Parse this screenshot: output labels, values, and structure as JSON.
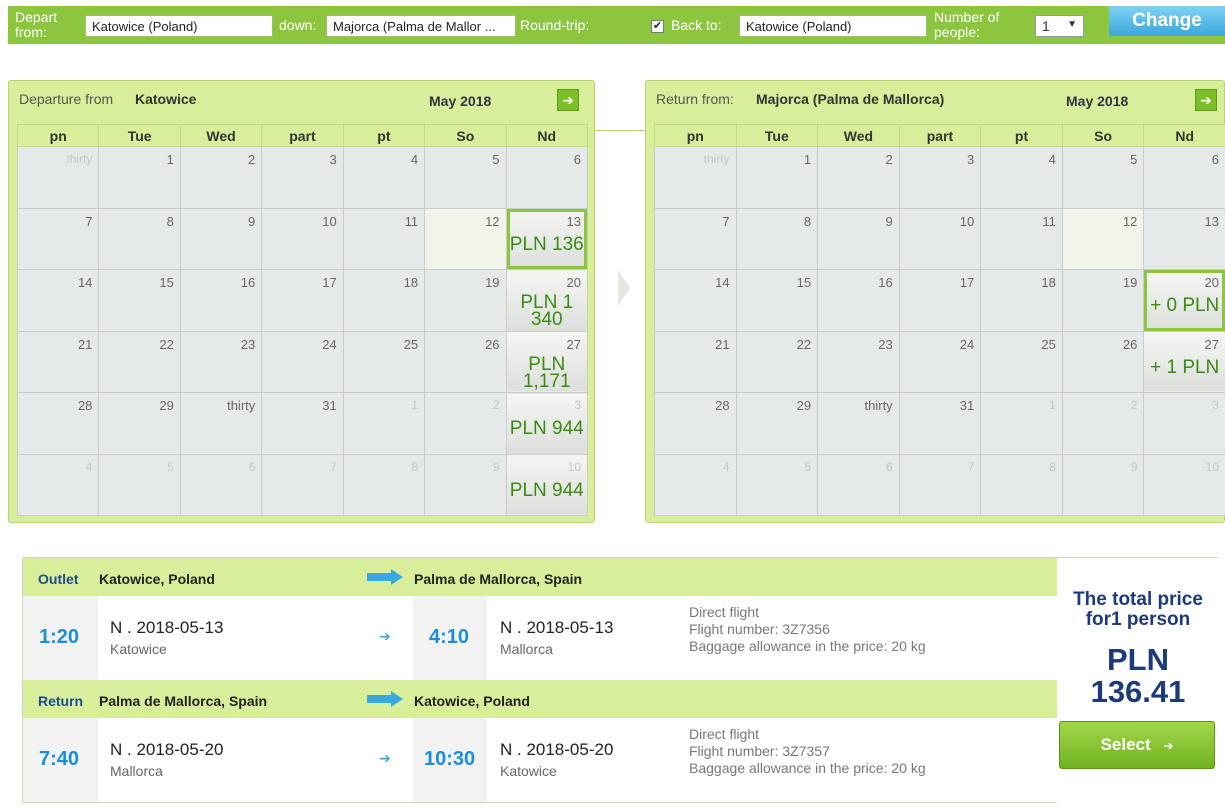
{
  "search": {
    "depart_label": "Depart\nfrom:",
    "depart_value": "Katowice (Poland)",
    "down_label": "down:",
    "down_value": "Majorca (Palma de Mallor ...",
    "roundtrip_label": "Round-trip:",
    "roundtrip_checked": "✔",
    "back_label": "Back to:",
    "back_value": "Katowice (Poland)",
    "people_label": "Number of\npeople:",
    "people_value": "1",
    "change_label": "Change"
  },
  "weekdays": [
    "pn",
    "Tue",
    "Wed",
    "part",
    "pt",
    "So",
    "Nd"
  ],
  "departure": {
    "label": "Departure from",
    "city": "Katowice",
    "month": "May 2018",
    "weeks": [
      [
        {
          "d": "thirty",
          "m": true
        },
        {
          "d": "1"
        },
        {
          "d": "2"
        },
        {
          "d": "3"
        },
        {
          "d": "4"
        },
        {
          "d": "5"
        },
        {
          "d": "6"
        }
      ],
      [
        {
          "d": "7"
        },
        {
          "d": "8"
        },
        {
          "d": "9"
        },
        {
          "d": "10"
        },
        {
          "d": "11"
        },
        {
          "d": "12",
          "today": true
        },
        {
          "d": "13",
          "price": "PLN 136",
          "sel": true
        }
      ],
      [
        {
          "d": "14"
        },
        {
          "d": "15"
        },
        {
          "d": "16"
        },
        {
          "d": "17"
        },
        {
          "d": "18"
        },
        {
          "d": "19"
        },
        {
          "d": "20",
          "price": "PLN 1 340"
        }
      ],
      [
        {
          "d": "21"
        },
        {
          "d": "22"
        },
        {
          "d": "23"
        },
        {
          "d": "24"
        },
        {
          "d": "25"
        },
        {
          "d": "26"
        },
        {
          "d": "27",
          "price": "PLN 1,171"
        }
      ],
      [
        {
          "d": "28"
        },
        {
          "d": "29"
        },
        {
          "d": "thirty"
        },
        {
          "d": "31"
        },
        {
          "d": "1",
          "m": true
        },
        {
          "d": "2",
          "m": true
        },
        {
          "d": "3",
          "m": true,
          "price": "PLN 944"
        }
      ],
      [
        {
          "d": "4",
          "m": true
        },
        {
          "d": "5",
          "m": true
        },
        {
          "d": "6",
          "m": true
        },
        {
          "d": "7",
          "m": true
        },
        {
          "d": "8",
          "m": true
        },
        {
          "d": "9",
          "m": true
        },
        {
          "d": "10",
          "m": true,
          "price": "PLN 944"
        }
      ]
    ]
  },
  "return": {
    "label": "Return from:",
    "city": "Majorca (Palma de Mallorca)",
    "month": "May 2018",
    "weeks": [
      [
        {
          "d": "thirty",
          "m": true
        },
        {
          "d": "1"
        },
        {
          "d": "2"
        },
        {
          "d": "3"
        },
        {
          "d": "4"
        },
        {
          "d": "5"
        },
        {
          "d": "6"
        }
      ],
      [
        {
          "d": "7"
        },
        {
          "d": "8"
        },
        {
          "d": "9"
        },
        {
          "d": "10"
        },
        {
          "d": "11"
        },
        {
          "d": "12",
          "today": true
        },
        {
          "d": "13"
        }
      ],
      [
        {
          "d": "14"
        },
        {
          "d": "15"
        },
        {
          "d": "16"
        },
        {
          "d": "17"
        },
        {
          "d": "18"
        },
        {
          "d": "19"
        },
        {
          "d": "20",
          "price": "+ 0 PLN",
          "sel": true
        }
      ],
      [
        {
          "d": "21"
        },
        {
          "d": "22"
        },
        {
          "d": "23"
        },
        {
          "d": "24"
        },
        {
          "d": "25"
        },
        {
          "d": "26"
        },
        {
          "d": "27",
          "price": "+ 1 PLN"
        }
      ],
      [
        {
          "d": "28"
        },
        {
          "d": "29"
        },
        {
          "d": "thirty"
        },
        {
          "d": "31"
        },
        {
          "d": "1",
          "m": true
        },
        {
          "d": "2",
          "m": true
        },
        {
          "d": "3",
          "m": true
        }
      ],
      [
        {
          "d": "4",
          "m": true
        },
        {
          "d": "5",
          "m": true
        },
        {
          "d": "6",
          "m": true
        },
        {
          "d": "7",
          "m": true
        },
        {
          "d": "8",
          "m": true
        },
        {
          "d": "9",
          "m": true
        },
        {
          "d": "10",
          "m": true
        }
      ]
    ]
  },
  "outlet": {
    "type": "Outlet",
    "from": "Katowice, Poland",
    "to": "Palma de Mallorca, Spain",
    "dep_time": "1:20",
    "dep_date": "N . 2018-05-13",
    "dep_city": "Katowice",
    "arr_time": "4:10",
    "arr_date": "N . 2018-05-13",
    "arr_city": "Mallorca",
    "info1": "Direct flight",
    "info2": "Flight number: 3Z7356",
    "info3": "Baggage allowance in the price: 20 kg"
  },
  "return_leg": {
    "type": "Return",
    "from": "Palma de Mallorca, Spain",
    "to": "Katowice, Poland",
    "dep_time": "7:40",
    "dep_date": "N . 2018-05-20",
    "dep_city": "Mallorca",
    "arr_time": "10:30",
    "arr_date": "N . 2018-05-20",
    "arr_city": "Katowice",
    "info1": "Direct flight",
    "info2": "Flight number: 3Z7357",
    "info3": "Baggage allowance in the price: 20 kg"
  },
  "total": {
    "label": "The total price for1 person",
    "price": "PLN 136.41",
    "select_label": "Select",
    "select_arrow": "➔"
  },
  "icons": {
    "next": "➔",
    "small_arrow": "➔"
  },
  "colors": {
    "accent_green": "#8cc63f",
    "panel_green": "#d9ee9b",
    "price_green": "#3a8a14",
    "time_blue": "#1a8fd8",
    "change_blue": "#3aa6dc",
    "total_navy": "#1d3a7a"
  }
}
